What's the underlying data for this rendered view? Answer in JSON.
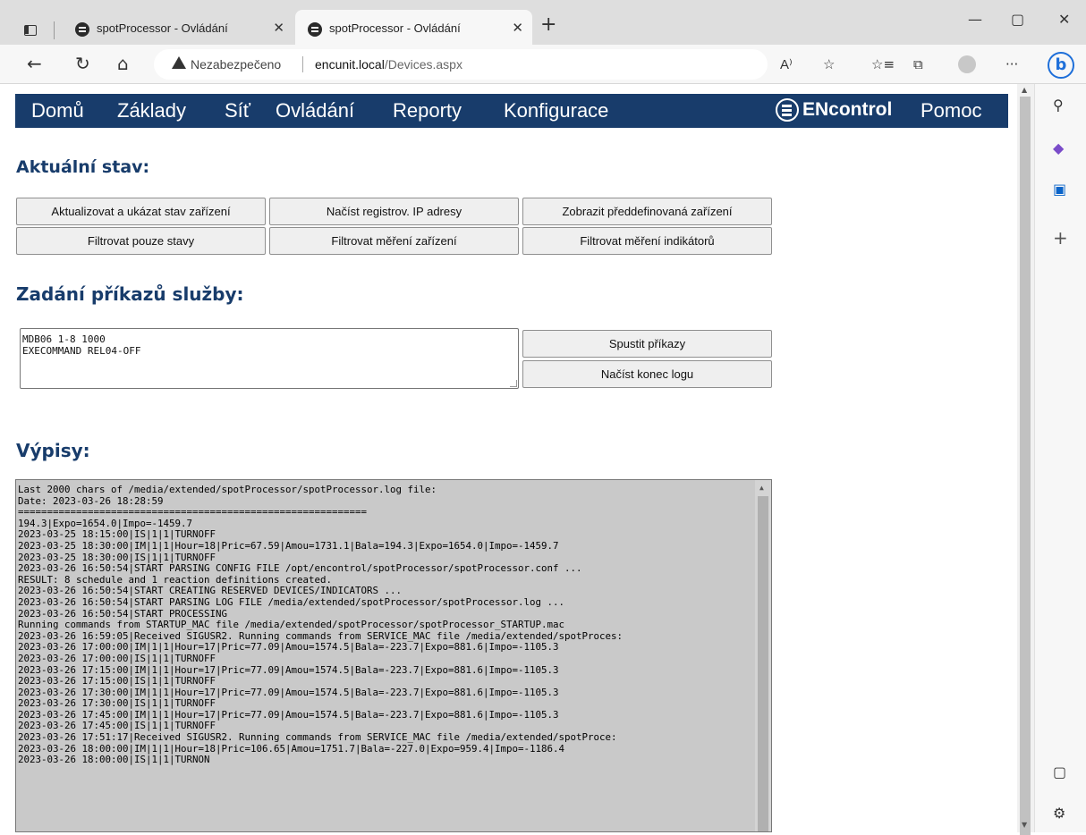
{
  "browser": {
    "tabs": [
      {
        "title": "spotProcessor - Ovládání",
        "close": "✕"
      },
      {
        "title": "spotProcessor - Ovládání",
        "close": "✕"
      }
    ],
    "new_tab": "+",
    "window": {
      "minimize": "—",
      "maximize": "▢",
      "close": "✕"
    },
    "address": {
      "security_label": "Nezabezpečeno",
      "host": "encunit.local",
      "path": "/Devices.aspx"
    },
    "nav": {
      "back": "←",
      "reload": "↻",
      "home": "⌂"
    },
    "toolbar": {
      "read_aloud": "A⁾",
      "favorite": "☆",
      "favorites": "☆≡",
      "collections": "⧉",
      "more": "···"
    },
    "bing": "b",
    "sidebar_icons": {
      "search": "⚲",
      "copilot": "◆",
      "outlook": "▣",
      "add": "+",
      "split": "▢",
      "settings": "⚙"
    }
  },
  "menu": {
    "items": [
      "Domů",
      "Základy",
      "Síť",
      "Ovládání",
      "Reporty",
      "Konfigurace"
    ],
    "logo": "ENcontrol",
    "help": "Pomoc"
  },
  "status": {
    "heading": "Aktuální stav:",
    "buttons": [
      "Aktualizovat a ukázat stav zařízení",
      "Načíst registrov. IP adresy",
      "Zobrazit předdefinovaná zařízení",
      "Filtrovat pouze stavy",
      "Filtrovat měření zařízení",
      "Filtrovat měření indikátorů"
    ]
  },
  "commands": {
    "heading": "Zadání příkazů služby:",
    "input_value": "MDB06 1-8 1000\nEXECOMMAND REL04-OFF",
    "run_button": "Spustit příkazy",
    "tail_button": "Načíst konec logu"
  },
  "logs": {
    "heading": "Výpisy:",
    "lines": [
      "Last 2000 chars of /media/extended/spotProcessor/spotProcessor.log file:",
      "Date: 2023-03-26 18:28:59",
      "============================================================",
      "194.3|Expo=1654.0|Impo=-1459.7",
      "2023-03-25 18:15:00|IS|1|1|TURNOFF",
      "2023-03-25 18:30:00|IM|1|1|Hour=18|Pric=67.59|Amou=1731.1|Bala=194.3|Expo=1654.0|Impo=-1459.7",
      "2023-03-25 18:30:00|IS|1|1|TURNOFF",
      "2023-03-26 16:50:54|START PARSING CONFIG FILE /opt/encontrol/spotProcessor/spotProcessor.conf ...",
      "RESULT: 8 schedule and 1 reaction definitions created.",
      "2023-03-26 16:50:54|START CREATING RESERVED DEVICES/INDICATORS ...",
      "2023-03-26 16:50:54|START PARSING LOG FILE /media/extended/spotProcessor/spotProcessor.log ...",
      "2023-03-26 16:50:54|START PROCESSING",
      "Running commands from STARTUP_MAC file /media/extended/spotProcessor/spotProcessor_STARTUP.mac",
      "2023-03-26 16:59:05|Received SIGUSR2. Running commands from SERVICE_MAC file /media/extended/spotProces:",
      "2023-03-26 17:00:00|IM|1|1|Hour=17|Pric=77.09|Amou=1574.5|Bala=-223.7|Expo=881.6|Impo=-1105.3",
      "2023-03-26 17:00:00|IS|1|1|TURNOFF",
      "2023-03-26 17:15:00|IM|1|1|Hour=17|Pric=77.09|Amou=1574.5|Bala=-223.7|Expo=881.6|Impo=-1105.3",
      "2023-03-26 17:15:00|IS|1|1|TURNOFF",
      "2023-03-26 17:30:00|IM|1|1|Hour=17|Pric=77.09|Amou=1574.5|Bala=-223.7|Expo=881.6|Impo=-1105.3",
      "2023-03-26 17:30:00|IS|1|1|TURNOFF",
      "2023-03-26 17:45:00|IM|1|1|Hour=17|Pric=77.09|Amou=1574.5|Bala=-223.7|Expo=881.6|Impo=-1105.3",
      "2023-03-26 17:45:00|IS|1|1|TURNOFF",
      "2023-03-26 17:51:17|Received SIGUSR2. Running commands from SERVICE_MAC file /media/extended/spotProce:",
      "2023-03-26 18:00:00|IM|1|1|Hour=18|Pric=106.65|Amou=1751.7|Bala=-227.0|Expo=959.4|Impo=-1186.4",
      "2023-03-26 18:00:00|IS|1|1|TURNON"
    ]
  },
  "colors": {
    "nav_bg": "#183c6b",
    "heading": "#183c6b",
    "log_bg": "#c9c9c9"
  }
}
